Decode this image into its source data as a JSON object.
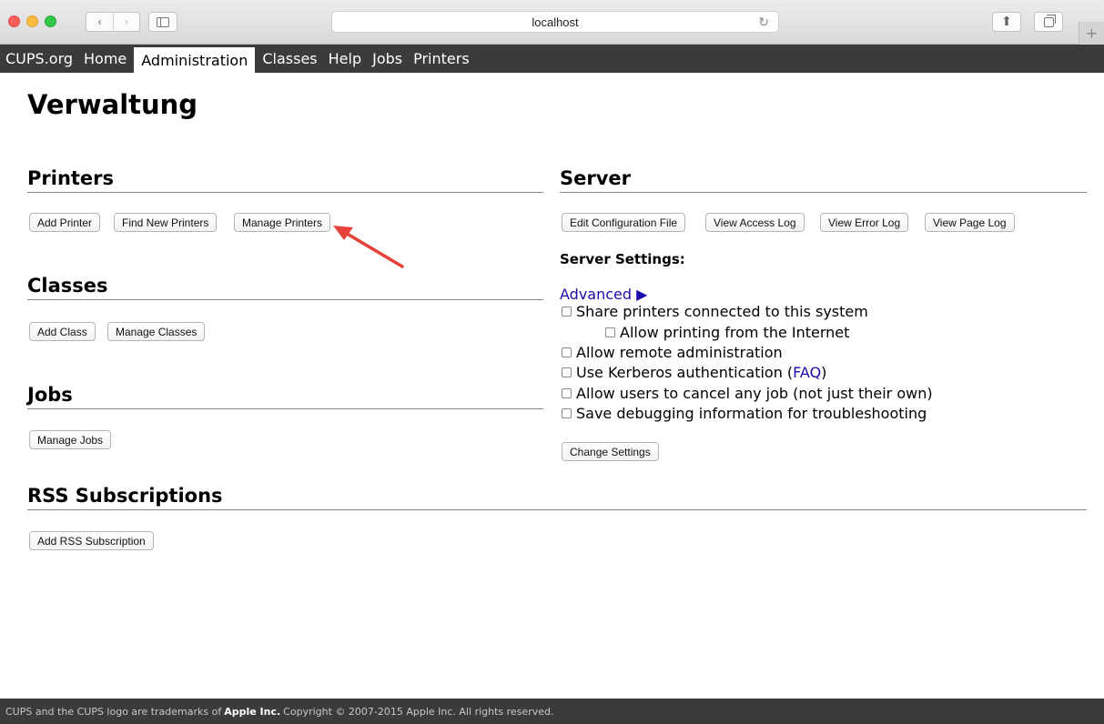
{
  "browser": {
    "address": "localhost",
    "icons": {
      "back": "chevron-left",
      "forward": "chevron-right",
      "reload": "reload",
      "share": "share",
      "tabs": "tabs",
      "new_tab": "plus"
    }
  },
  "nav": {
    "items": [
      {
        "label": "CUPS.org"
      },
      {
        "label": "Home"
      },
      {
        "label": "Administration",
        "active": true
      },
      {
        "label": "Classes"
      },
      {
        "label": "Help"
      },
      {
        "label": "Jobs"
      },
      {
        "label": "Printers"
      }
    ]
  },
  "page": {
    "title": "Verwaltung"
  },
  "printers": {
    "heading": "Printers",
    "buttons": [
      "Add Printer",
      "Find New Printers",
      "Manage Printers"
    ]
  },
  "classes": {
    "heading": "Classes",
    "buttons": [
      "Add Class",
      "Manage Classes"
    ]
  },
  "jobs": {
    "heading": "Jobs",
    "buttons": [
      "Manage Jobs"
    ]
  },
  "rss": {
    "heading": "RSS Subscriptions",
    "buttons": [
      "Add RSS Subscription"
    ]
  },
  "server": {
    "heading": "Server",
    "buttons": [
      "Edit Configuration File",
      "View Access Log",
      "View Error Log",
      "View Page Log"
    ],
    "settings_label": "Server Settings:",
    "advanced_link": "Advanced ▶",
    "options": [
      {
        "label": "Share printers connected to this system",
        "checked": false
      },
      {
        "label": "Allow printing from the Internet",
        "checked": false
      },
      {
        "label": "Allow remote administration",
        "checked": false
      },
      {
        "label": "Use Kerberos authentication (",
        "link": "FAQ",
        "suffix": ")",
        "checked": false
      },
      {
        "label": "Allow users to cancel any job (not just their own)",
        "checked": false
      },
      {
        "label": "Save debugging information for troubleshooting",
        "checked": false
      }
    ],
    "change_button": "Change Settings"
  },
  "footer": {
    "prefix": "CUPS and the CUPS logo are trademarks of",
    "company": "Apple Inc.",
    "suffix": "Copyright © 2007-2015 Apple Inc. All rights reserved."
  },
  "colors": {
    "nav_bg": "#3b3b3b",
    "link": "#1a0dab",
    "arrow": "#e8413a"
  }
}
